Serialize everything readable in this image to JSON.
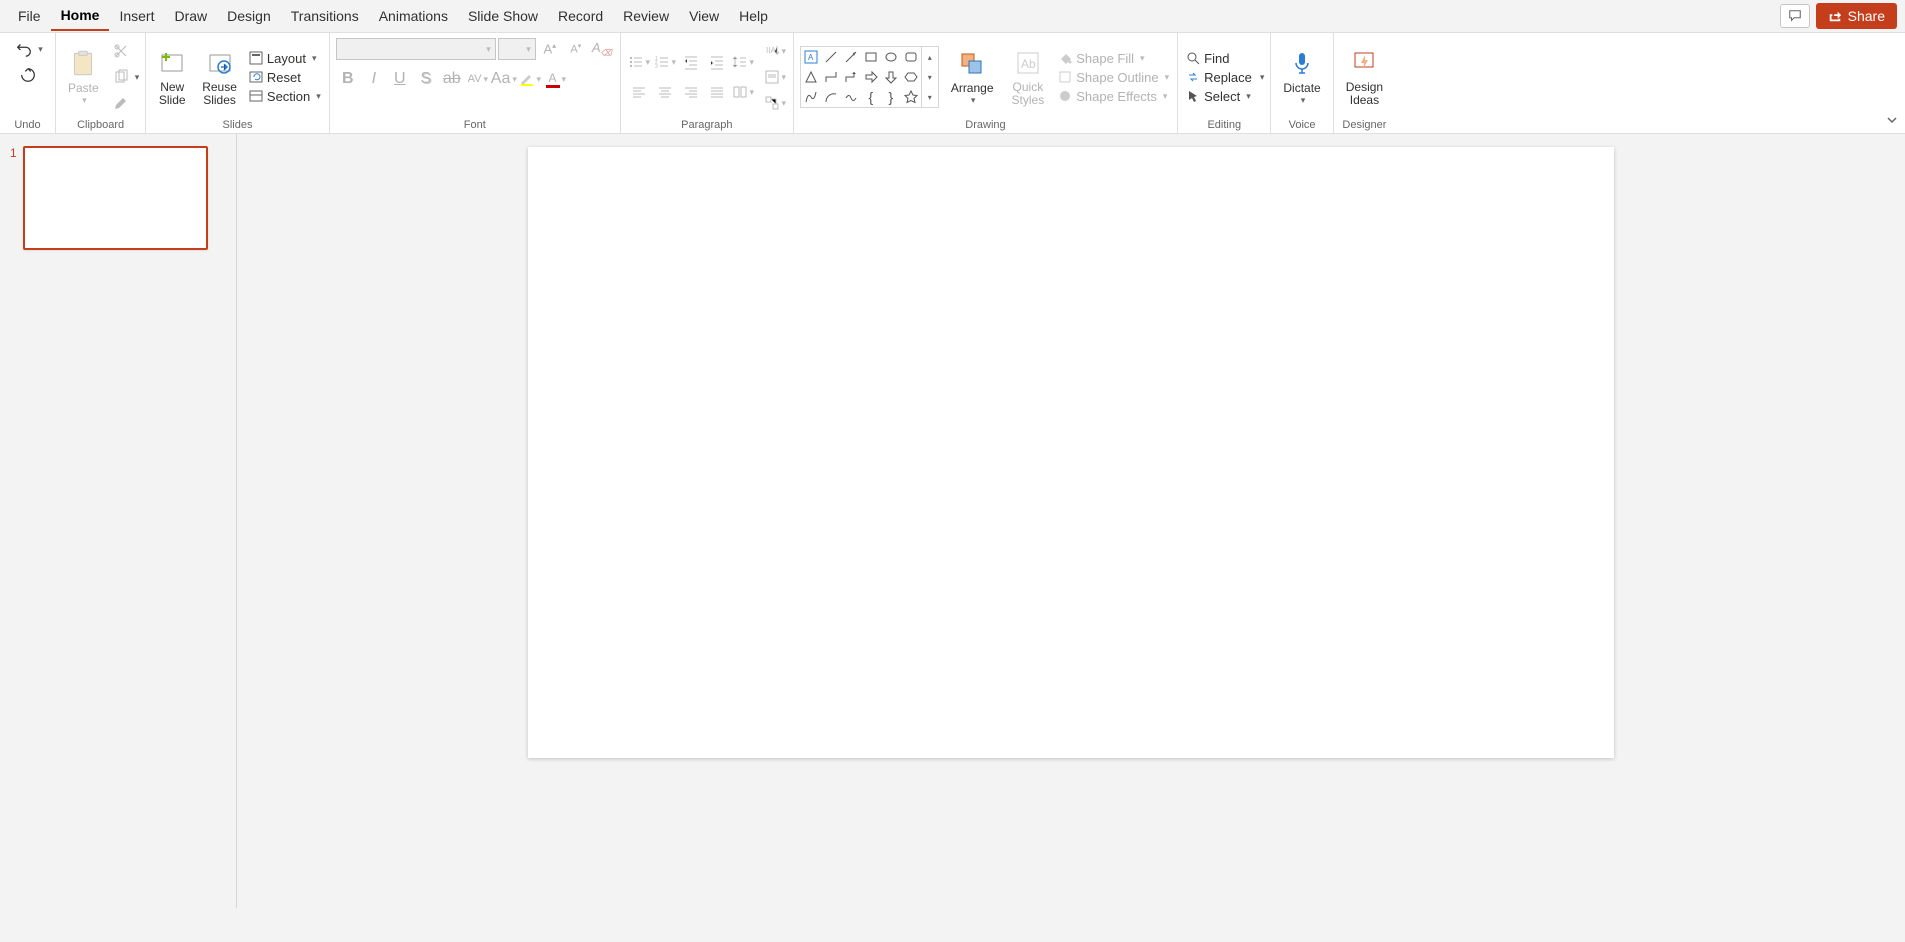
{
  "tabs": [
    "File",
    "Home",
    "Insert",
    "Draw",
    "Design",
    "Transitions",
    "Animations",
    "Slide Show",
    "Record",
    "Review",
    "View",
    "Help"
  ],
  "activeTab": "Home",
  "share": "Share",
  "groups": {
    "undo": "Undo",
    "clipboard": "Clipboard",
    "slides": "Slides",
    "font": "Font",
    "paragraph": "Paragraph",
    "drawing": "Drawing",
    "editing": "Editing",
    "voice": "Voice",
    "designer": "Designer"
  },
  "clipboard": {
    "paste": "Paste"
  },
  "slides": {
    "newSlide": "New\nSlide",
    "reuseSlides": "Reuse\nSlides",
    "layout": "Layout",
    "reset": "Reset",
    "section": "Section"
  },
  "font": {
    "name": "",
    "size": ""
  },
  "drawing": {
    "arrange": "Arrange",
    "quickStyles": "Quick\nStyles",
    "shapeFill": "Shape Fill",
    "shapeOutline": "Shape Outline",
    "shapeEffects": "Shape Effects"
  },
  "editing": {
    "find": "Find",
    "replace": "Replace",
    "select": "Select"
  },
  "voice": {
    "dictate": "Dictate"
  },
  "designer": {
    "designIdeas": "Design\nIdeas"
  },
  "thumbs": [
    {
      "num": "1"
    }
  ]
}
